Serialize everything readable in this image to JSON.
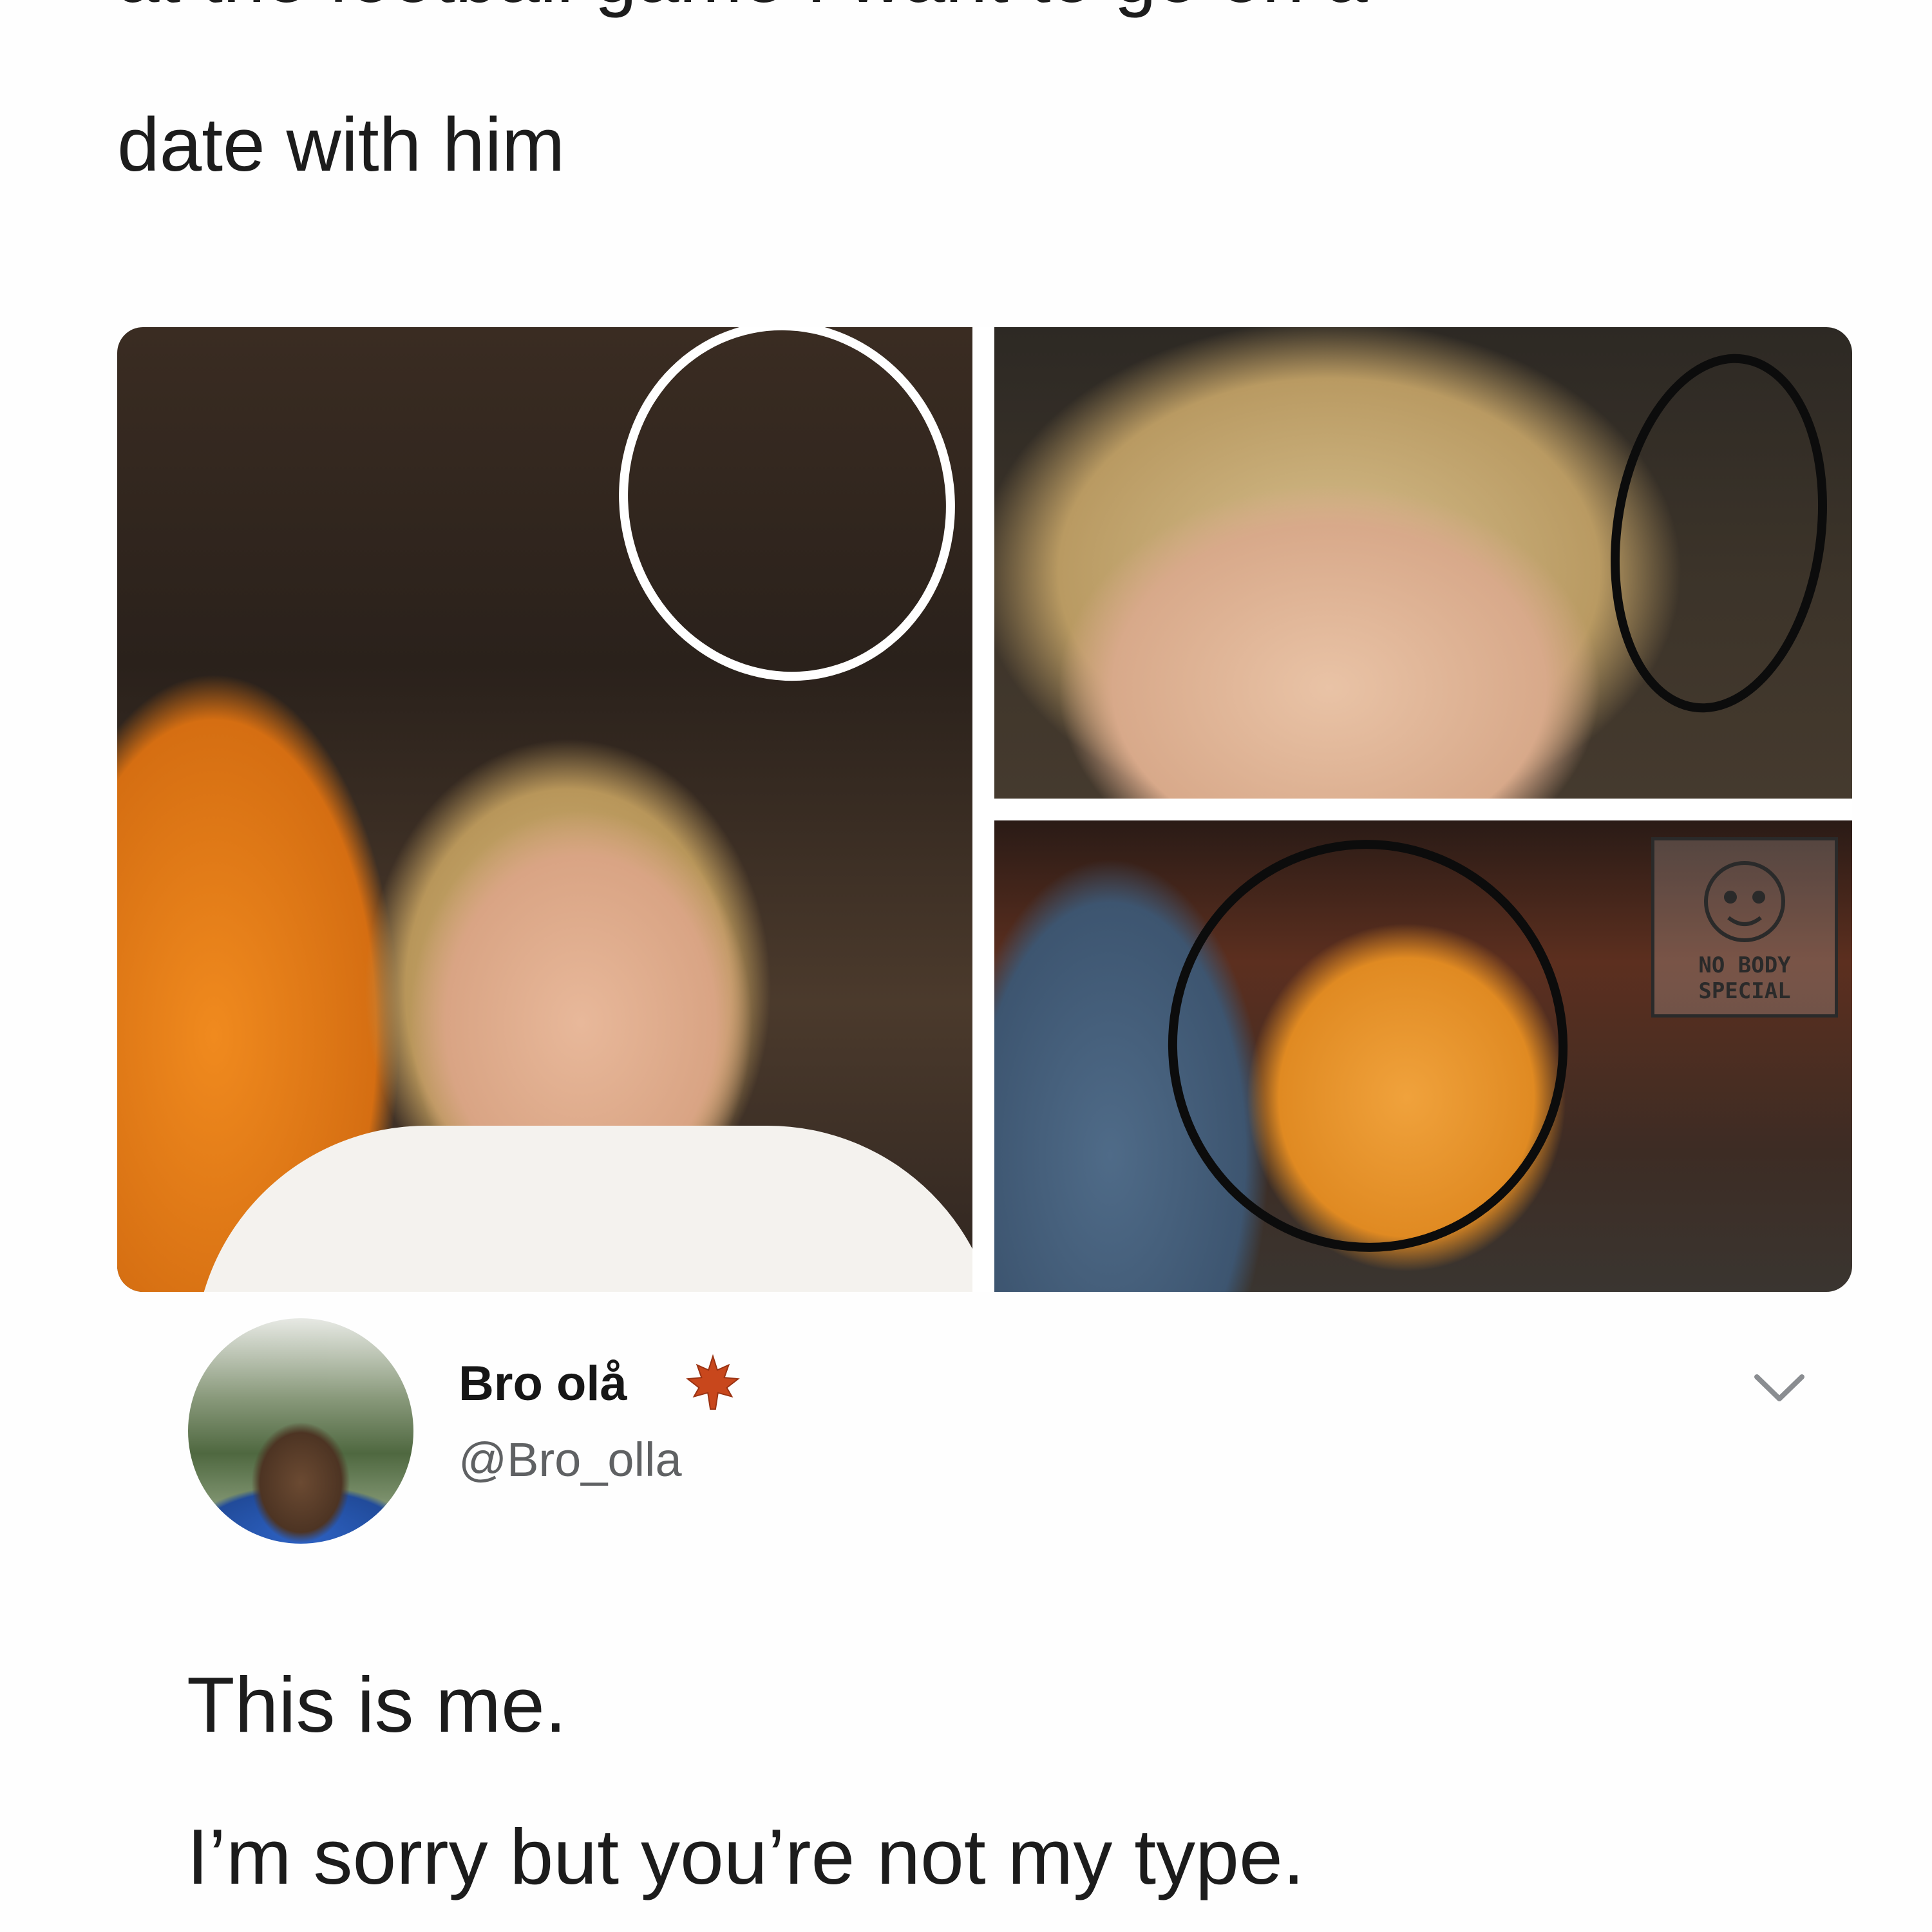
{
  "tweet": {
    "text_line1_cropped": "at the football game I want to go on a",
    "text_line2": "date with him"
  },
  "media": {
    "watermark_line1": "NO BODY",
    "watermark_line2": "SPECIAL"
  },
  "reply": {
    "display_name": "Bro olå",
    "handle": "@Bro_olla",
    "line1": "This is me.",
    "line2": "I’m sorry but you’re not my type.",
    "name_icon": "maple-leaf-icon",
    "menu_icon": "chevron-down-icon"
  },
  "colors": {
    "text": "#1c1c1c",
    "handle": "#5f6163",
    "orange": "#f08a1e",
    "leaf": "#c8471c"
  }
}
